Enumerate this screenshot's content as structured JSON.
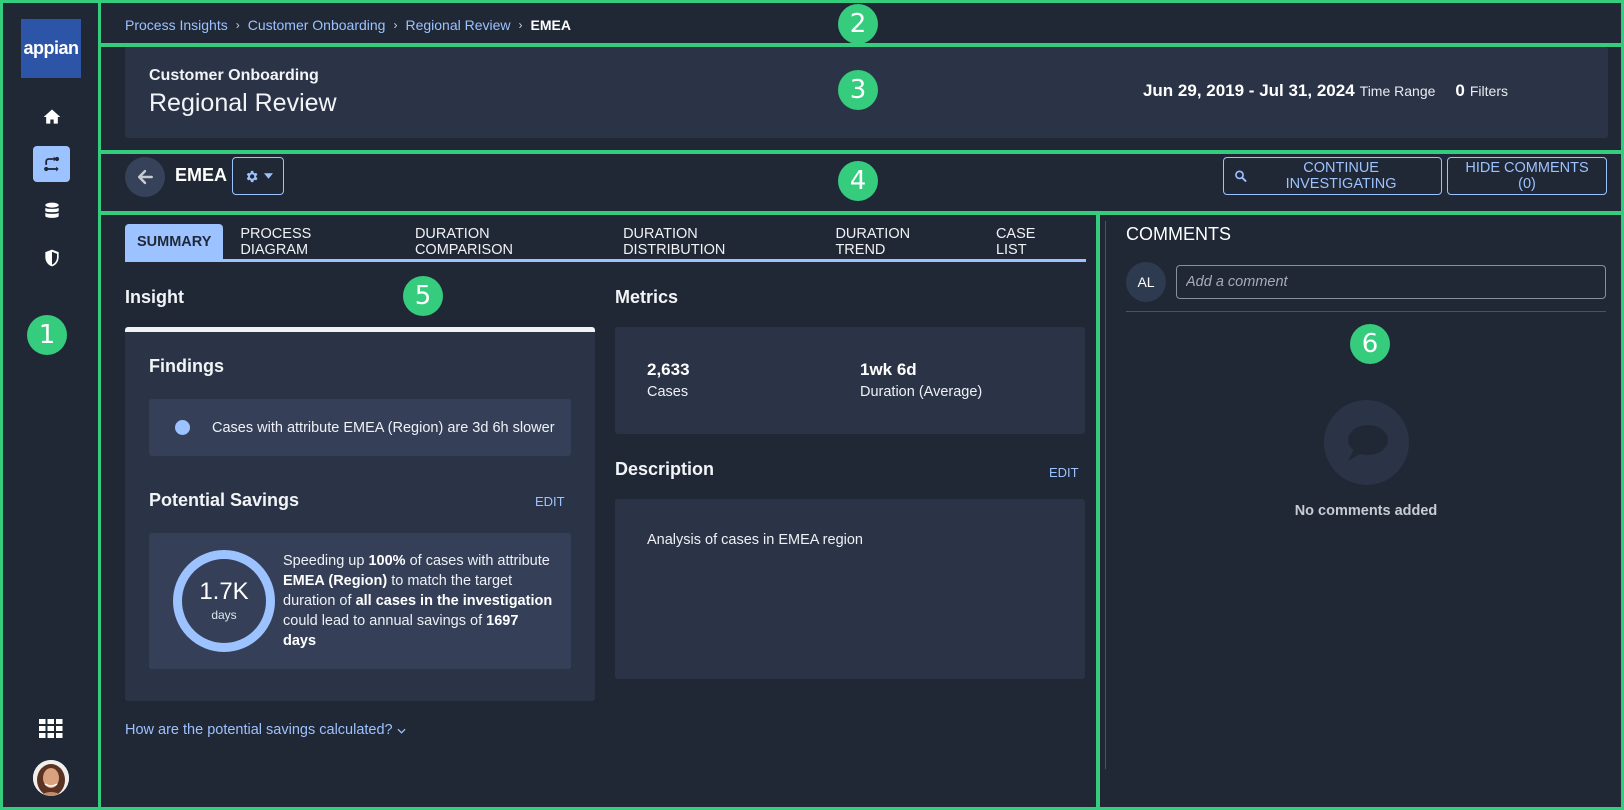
{
  "app": {
    "logo_text": "appian"
  },
  "sidebar": {
    "items": [
      {
        "icon": "home-icon",
        "label": "Home",
        "active": false
      },
      {
        "icon": "process-icon",
        "label": "Process Insights",
        "active": true
      },
      {
        "icon": "database-icon",
        "label": "Data",
        "active": false
      },
      {
        "icon": "shield-icon",
        "label": "Security",
        "active": false
      }
    ],
    "apps_icon": "grid-icon",
    "user_avatar": "user-photo"
  },
  "breadcrumb": {
    "items": [
      "Process Insights",
      "Customer Onboarding",
      "Regional Review"
    ],
    "current": "EMEA",
    "separator": "›"
  },
  "header": {
    "subtitle": "Customer Onboarding",
    "title": "Regional Review",
    "time_range_value": "Jun 29, 2019 - Jul 31, 2024",
    "time_range_label": "Time Range",
    "filters_count": "0",
    "filters_label": "Filters"
  },
  "toolbar": {
    "back_icon": "arrow-left-icon",
    "entity_name": "EMEA",
    "gear_icon": "gear-icon",
    "continue_label": "CONTINUE INVESTIGATING",
    "hide_comments_label": "HIDE COMMENTS (0)"
  },
  "tabs": [
    {
      "label": "SUMMARY",
      "active": true
    },
    {
      "label": "PROCESS DIAGRAM",
      "active": false
    },
    {
      "label": "DURATION COMPARISON",
      "active": false
    },
    {
      "label": "DURATION DISTRIBUTION",
      "active": false
    },
    {
      "label": "DURATION TREND",
      "active": false
    },
    {
      "label": "CASE LIST",
      "active": false
    }
  ],
  "insight": {
    "heading": "Insight",
    "findings_heading": "Findings",
    "findings": [
      "Cases with attribute EMEA (Region) are 3d 6h slower"
    ],
    "savings_heading": "Potential Savings",
    "savings_edit": "EDIT",
    "savings_value": "1.7K",
    "savings_unit": "days",
    "savings_text": {
      "p1": "Speeding up ",
      "b1": "100%",
      "p2": " of cases with attribute ",
      "b2": "EMEA (Region)",
      "p3": " to match the target duration of ",
      "b3": "all cases in the investigation",
      "p4": " could lead to annual savings of ",
      "b4": "1697 days"
    },
    "how_link": "How are the potential savings calculated?"
  },
  "metrics": {
    "heading": "Metrics",
    "items": [
      {
        "value": "2,633",
        "label": "Cases"
      },
      {
        "value": "1wk 6d",
        "label": "Duration (Average)"
      }
    ]
  },
  "description": {
    "heading": "Description",
    "edit": "EDIT",
    "text": "Analysis of cases in EMEA region"
  },
  "comments": {
    "heading": "COMMENTS",
    "avatar_initials": "AL",
    "input_placeholder": "Add a comment",
    "input_value": "",
    "empty_text": "No comments added"
  },
  "annotations": [
    "1",
    "2",
    "3",
    "4",
    "5",
    "6"
  ],
  "colors": {
    "accent": "#9cc2ff",
    "background": "#202735",
    "card": "#2b3446",
    "logo": "#2d55a7",
    "annotation": "#36cc7e"
  }
}
